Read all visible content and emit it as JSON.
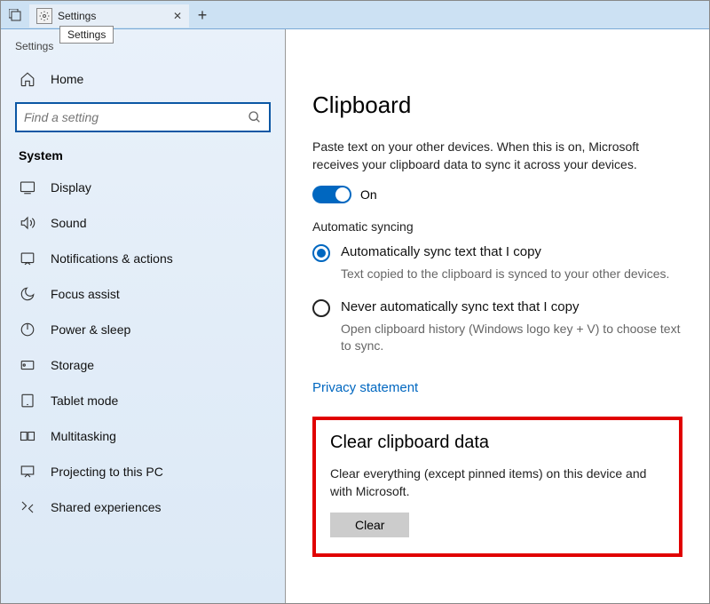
{
  "tabbar": {
    "tab_title": "Settings",
    "tooltip": "Settings"
  },
  "app_title": "Settings",
  "sidebar": {
    "home": "Home",
    "search_placeholder": "Find a setting",
    "group": "System",
    "items": [
      {
        "label": "Display"
      },
      {
        "label": "Sound"
      },
      {
        "label": "Notifications & actions"
      },
      {
        "label": "Focus assist"
      },
      {
        "label": "Power & sleep"
      },
      {
        "label": "Storage"
      },
      {
        "label": "Tablet mode"
      },
      {
        "label": "Multitasking"
      },
      {
        "label": "Projecting to this PC"
      },
      {
        "label": "Shared experiences"
      }
    ]
  },
  "main": {
    "heading": "Clipboard",
    "desc": "Paste text on your other devices. When this is on, Microsoft receives your clipboard data to sync it across your devices.",
    "toggle_state": "On",
    "sync_heading": "Automatic syncing",
    "radio1": "Automatically sync text that I copy",
    "radio1_desc": "Text copied to the clipboard is synced to your other devices.",
    "radio2": "Never automatically sync text that I copy",
    "radio2_desc": "Open clipboard history (Windows logo key + V) to choose text to sync.",
    "privacy_link": "Privacy statement",
    "clear_heading": "Clear clipboard data",
    "clear_desc": "Clear everything (except pinned items) on this device and with Microsoft.",
    "clear_button": "Clear"
  }
}
